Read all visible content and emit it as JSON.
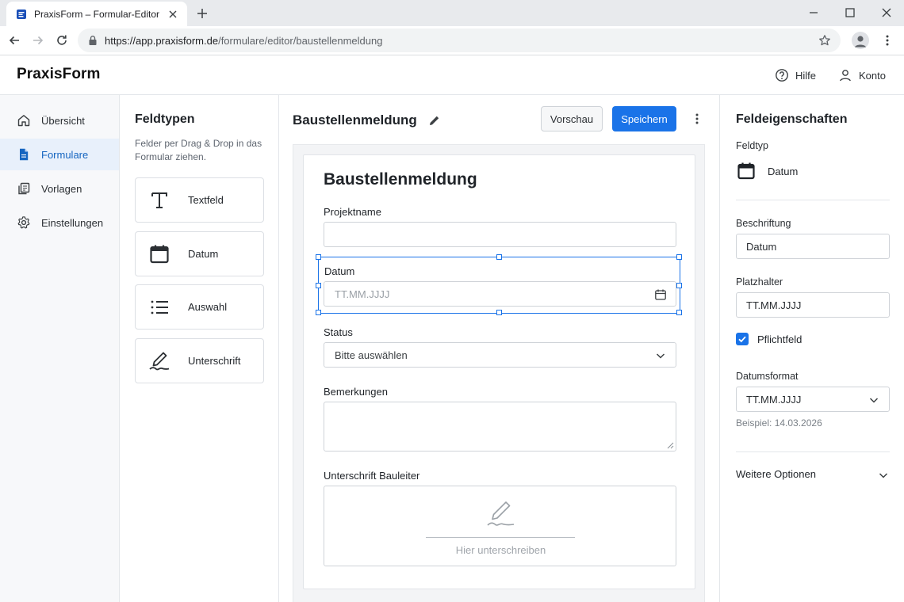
{
  "browser": {
    "tab_title": "PraxisForm – Formular-Editor",
    "url_host": "https://app.praxisform.de",
    "url_path": "/formulare/editor/baustellenmeldung"
  },
  "header": {
    "brand": "PraxisForm",
    "help_label": "Hilfe",
    "account_label": "Konto"
  },
  "sidebar": {
    "items": [
      {
        "label": "Übersicht",
        "icon": "home-icon",
        "active": false
      },
      {
        "label": "Formulare",
        "icon": "document-icon",
        "active": true
      },
      {
        "label": "Vorlagen",
        "icon": "templates-icon",
        "active": false
      },
      {
        "label": "Einstellungen",
        "icon": "gear-icon",
        "active": false
      }
    ]
  },
  "fieldtypes": {
    "title": "Feldtypen",
    "help": "Felder per Drag & Drop in das Formular ziehen.",
    "items": [
      {
        "label": "Textfeld",
        "icon": "text-icon"
      },
      {
        "label": "Datum",
        "icon": "calendar-icon"
      },
      {
        "label": "Auswahl",
        "icon": "list-icon"
      },
      {
        "label": "Unterschrift",
        "icon": "signature-icon"
      }
    ]
  },
  "editor": {
    "title": "Baustellenmeldung",
    "preview_label": "Vorschau",
    "save_label": "Speichern",
    "accent_color": "#1a73e8",
    "form": {
      "title": "Baustellenmeldung",
      "fields": {
        "project": {
          "label": "Projektname",
          "value": ""
        },
        "date": {
          "label": "Datum",
          "placeholder": "TT.MM.JJJJ",
          "selected": true
        },
        "status": {
          "label": "Status",
          "value": "Bitte auswählen"
        },
        "remarks": {
          "label": "Bemerkungen",
          "value": ""
        },
        "signature": {
          "label": "Unterschrift Bauleiter",
          "hint": "Hier unterschreiben"
        }
      }
    }
  },
  "properties": {
    "title": "Feldeigenschaften",
    "field_type_label": "Feldtyp",
    "field_type_value": "Datum",
    "caption_label": "Beschriftung",
    "caption_value": "Datum",
    "placeholder_label": "Platzhalter",
    "placeholder_value": "TT.MM.JJJJ",
    "required_label": "Pflichtfeld",
    "required_checked": true,
    "date_format_label": "Datumsformat",
    "date_format_value": "TT.MM.JJJJ",
    "example": "Beispiel: 14.03.2026",
    "more_options": "Weitere Optionen"
  }
}
